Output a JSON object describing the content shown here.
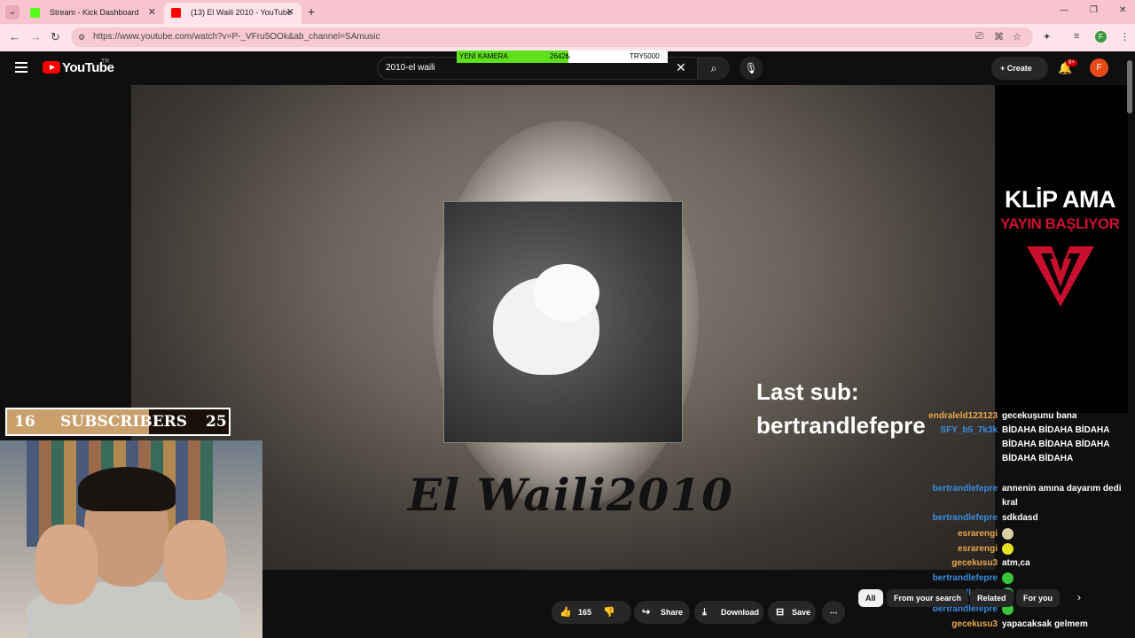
{
  "browser": {
    "tabs": [
      {
        "title": "Stream - Kick Dashboard",
        "favicon_color": "#53fc18"
      },
      {
        "title": "(13) El Waili 2010 - YouTube",
        "favicon_color": "#ff0000"
      }
    ],
    "url": "https://www.youtube.com/watch?v=P-_VFru5OOk&ab_channel=SAmusic",
    "profile_initial": "F"
  },
  "youtube": {
    "logo_text": "YouTube",
    "country": "TR",
    "search_value": "2010-el waili",
    "create_label": "Create",
    "notifications_badge": "9+",
    "avatar_initial": "F"
  },
  "ticker": {
    "label": "YENİ KAMERA",
    "amount": "2642₺",
    "goal": "TRY5000",
    "progress_fraction": 0.53
  },
  "video": {
    "caption": "El Waili2010"
  },
  "overlay": {
    "klip": "KLİP AMA",
    "yayin": "YAYIN BAŞLIYOR",
    "last_sub_label": "Last sub:",
    "last_sub_name": "bertrandlefepre",
    "subscribers": {
      "current": "16",
      "label": "SUBSCRIBERS",
      "goal": "25",
      "progress_fraction": 0.64
    }
  },
  "chat": [
    {
      "user": "endraleld123123",
      "text": "gecekuşunu bana",
      "color": "#e9a84c"
    },
    {
      "user": "SFY_b5_7k3k",
      "text": "BİDAHA BİDAHA BİDAHA BİDAHA BİDAHA BİDAHA BİDAHA BİDAHA",
      "color": "#3a8de0"
    },
    {
      "user": "bertrandlefepre",
      "text": "annenin amına dayarım dedi kral",
      "color": "#3a8de0"
    },
    {
      "user": "bertrandlefepre",
      "text": "sdkdasd",
      "color": "#3a8de0"
    },
    {
      "user": "esrarengi",
      "text": "",
      "emote": "#d9cfa8",
      "color": "#e9a84c"
    },
    {
      "user": "esrarengi",
      "text": "",
      "emote": "#e6e020",
      "color": "#e9a84c"
    },
    {
      "user": "gecekusu3",
      "text": "atm,ca",
      "color": "#e9a84c"
    },
    {
      "user": "bertrandlefepre",
      "text": "",
      "emote": "#3ac43a",
      "color": "#3a8de0"
    },
    {
      "user": "bertrandlefepre",
      "text": "",
      "emote": "#3ac43a",
      "color": "#3a8de0"
    },
    {
      "user": "bertrandlefepre",
      "text": "",
      "emote": "#3ac43a",
      "color": "#3a8de0"
    },
    {
      "user": "gecekusu3",
      "text": "yapacaksak gelmem",
      "color": "#e9a84c"
    }
  ],
  "actions": {
    "likes": "165",
    "share": "Share",
    "download": "Download",
    "save": "Save"
  },
  "chips": [
    "All",
    "From your search",
    "Related",
    "For you"
  ]
}
